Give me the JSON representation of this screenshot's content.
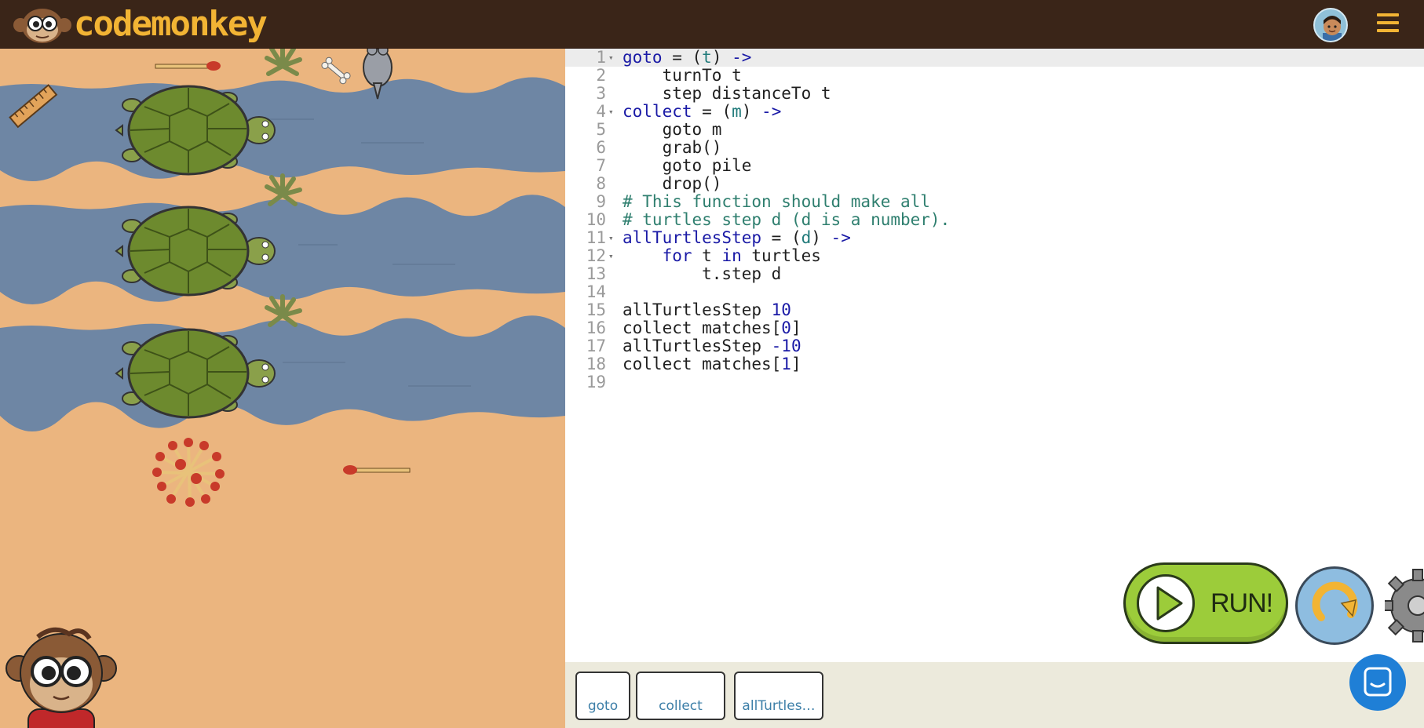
{
  "header": {
    "logo_text": "codemonkey",
    "logo_icon": "monkey-face-icon",
    "avatar_icon": "user-avatar-icon",
    "menu_icon": "hamburger-menu-icon",
    "brand_color": "#f2b434",
    "bar_color": "#3a2518"
  },
  "board": {
    "sand_color": "#ebb57f",
    "water_color": "#6e86a4",
    "items": [
      "ruler",
      "match",
      "bush",
      "bone",
      "rat",
      "turtle",
      "turtle",
      "turtle",
      "bush",
      "bush",
      "match-pile",
      "match",
      "monkey"
    ]
  },
  "editor": {
    "lines": [
      {
        "n": "1",
        "fold": "▾",
        "html": "<span class=\"kw\">goto</span> = (<span class=\"pr\">t</span>) <span class=\"kw\">-></span>"
      },
      {
        "n": "2",
        "fold": "",
        "html": "    turnTo t"
      },
      {
        "n": "3",
        "fold": "",
        "html": "    step distanceTo t"
      },
      {
        "n": "4",
        "fold": "▾",
        "html": "<span class=\"kw\">collect</span> = (<span class=\"pr\">m</span>) <span class=\"kw\">-></span>"
      },
      {
        "n": "5",
        "fold": "",
        "html": "    goto m"
      },
      {
        "n": "6",
        "fold": "",
        "html": "    grab()"
      },
      {
        "n": "7",
        "fold": "",
        "html": "    goto pile"
      },
      {
        "n": "8",
        "fold": "",
        "html": "    drop()"
      },
      {
        "n": "9",
        "fold": "",
        "html": "<span class=\"cm\"># This function should make all</span>"
      },
      {
        "n": "10",
        "fold": "",
        "html": "<span class=\"cm\"># turtles step d (d is a number).</span>"
      },
      {
        "n": "11",
        "fold": "▾",
        "html": "<span class=\"kw\">allTurtlesStep</span> = (<span class=\"pr\">d</span>) <span class=\"kw\">-></span>"
      },
      {
        "n": "12",
        "fold": "▾",
        "html": "    <span class=\"kw\">for</span> t <span class=\"kw\">in</span> turtles"
      },
      {
        "n": "13",
        "fold": "",
        "html": "        t.step d"
      },
      {
        "n": "14",
        "fold": "",
        "html": ""
      },
      {
        "n": "15",
        "fold": "",
        "html": "allTurtlesStep <span class=\"nm\">10</span>"
      },
      {
        "n": "16",
        "fold": "",
        "html": "collect matches[<span class=\"nm\">0</span>]"
      },
      {
        "n": "17",
        "fold": "",
        "html": "allTurtlesStep <span class=\"nm\">-10</span>"
      },
      {
        "n": "18",
        "fold": "",
        "html": "collect matches[<span class=\"nm\">1</span>]"
      },
      {
        "n": "19",
        "fold": "",
        "html": ""
      }
    ]
  },
  "controls": {
    "run_label": "RUN!",
    "run_icon": "play-icon",
    "reset_icon": "reset-arrow-icon",
    "settings_icon": "gear-icon",
    "run_color": "#9ccc3a",
    "reset_color": "#8ebde0"
  },
  "tabs": [
    {
      "label": "goto"
    },
    {
      "label": "collect"
    },
    {
      "label": "allTurtles…"
    }
  ],
  "chat": {
    "icon": "chat-icon"
  }
}
